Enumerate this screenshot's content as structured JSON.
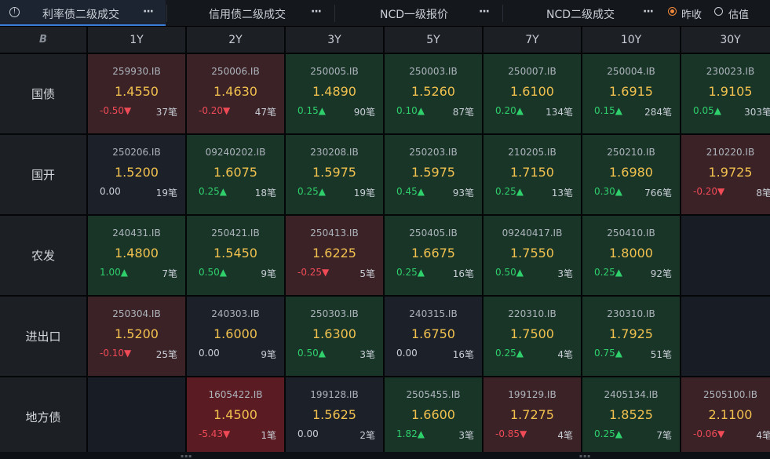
{
  "tabs": [
    {
      "label": "利率债二级成交",
      "more": "···",
      "active": true
    },
    {
      "label": "信用债二级成交",
      "more": "···",
      "active": false
    },
    {
      "label": "NCD一级报价",
      "more": "···",
      "active": false
    },
    {
      "label": "NCD二级成交",
      "more": "···",
      "active": false
    }
  ],
  "radios": [
    {
      "label": "昨收",
      "selected": true
    },
    {
      "label": "估值",
      "selected": false
    }
  ],
  "corner_logo": "B",
  "columns": [
    "1Y",
    "2Y",
    "3Y",
    "5Y",
    "7Y",
    "10Y",
    "30Y"
  ],
  "rows": [
    {
      "label": "国债",
      "cells": [
        {
          "code": "259930.IB",
          "yield": "1.4550",
          "change": "-0.50▼",
          "count": "37笔",
          "tone": "r"
        },
        {
          "code": "250006.IB",
          "yield": "1.4630",
          "change": "-0.20▼",
          "count": "47笔",
          "tone": "r"
        },
        {
          "code": "250005.IB",
          "yield": "1.4890",
          "change": "0.15▲",
          "count": "90笔",
          "tone": "g"
        },
        {
          "code": "250003.IB",
          "yield": "1.5260",
          "change": "0.10▲",
          "count": "87笔",
          "tone": "g"
        },
        {
          "code": "250007.IB",
          "yield": "1.6100",
          "change": "0.20▲",
          "count": "134笔",
          "tone": "g"
        },
        {
          "code": "250004.IB",
          "yield": "1.6915",
          "change": "0.15▲",
          "count": "284笔",
          "tone": "g"
        },
        {
          "code": "230023.IB",
          "yield": "1.9105",
          "change": "0.05▲",
          "count": "303笔",
          "tone": "g"
        }
      ]
    },
    {
      "label": "国开",
      "cells": [
        {
          "code": "250206.IB",
          "yield": "1.5200",
          "change": "0.00",
          "count": "19笔",
          "tone": "n"
        },
        {
          "code": "09240202.IB",
          "yield": "1.6075",
          "change": "0.25▲",
          "count": "18笔",
          "tone": "g"
        },
        {
          "code": "230208.IB",
          "yield": "1.5975",
          "change": "0.25▲",
          "count": "19笔",
          "tone": "g"
        },
        {
          "code": "250203.IB",
          "yield": "1.5975",
          "change": "0.45▲",
          "count": "93笔",
          "tone": "g"
        },
        {
          "code": "210205.IB",
          "yield": "1.7150",
          "change": "0.25▲",
          "count": "13笔",
          "tone": "g"
        },
        {
          "code": "250210.IB",
          "yield": "1.6980",
          "change": "0.30▲",
          "count": "766笔",
          "tone": "g"
        },
        {
          "code": "210220.IB",
          "yield": "1.9725",
          "change": "-0.20▼",
          "count": "8笔",
          "tone": "r"
        }
      ]
    },
    {
      "label": "农发",
      "cells": [
        {
          "code": "240431.IB",
          "yield": "1.4800",
          "change": "1.00▲",
          "count": "7笔",
          "tone": "g"
        },
        {
          "code": "250421.IB",
          "yield": "1.5450",
          "change": "0.50▲",
          "count": "9笔",
          "tone": "g"
        },
        {
          "code": "250413.IB",
          "yield": "1.6225",
          "change": "-0.25▼",
          "count": "5笔",
          "tone": "r"
        },
        {
          "code": "250405.IB",
          "yield": "1.6675",
          "change": "0.25▲",
          "count": "16笔",
          "tone": "g"
        },
        {
          "code": "09240417.IB",
          "yield": "1.7550",
          "change": "0.50▲",
          "count": "3笔",
          "tone": "g"
        },
        {
          "code": "250410.IB",
          "yield": "1.8000",
          "change": "0.25▲",
          "count": "92笔",
          "tone": "g"
        },
        null
      ]
    },
    {
      "label": "进出口",
      "cells": [
        {
          "code": "250304.IB",
          "yield": "1.5200",
          "change": "-0.10▼",
          "count": "25笔",
          "tone": "r"
        },
        {
          "code": "240303.IB",
          "yield": "1.6000",
          "change": "0.00",
          "count": "9笔",
          "tone": "n"
        },
        {
          "code": "250303.IB",
          "yield": "1.6300",
          "change": "0.50▲",
          "count": "3笔",
          "tone": "g"
        },
        {
          "code": "240315.IB",
          "yield": "1.6750",
          "change": "0.00",
          "count": "16笔",
          "tone": "n"
        },
        {
          "code": "220310.IB",
          "yield": "1.7500",
          "change": "0.25▲",
          "count": "4笔",
          "tone": "g"
        },
        {
          "code": "230310.IB",
          "yield": "1.7925",
          "change": "0.75▲",
          "count": "51笔",
          "tone": "g"
        },
        null
      ]
    },
    {
      "label": "地方债",
      "cells": [
        null,
        {
          "code": "1605422.IB",
          "yield": "1.4500",
          "change": "-5.43▼",
          "count": "1笔",
          "tone": "rr"
        },
        {
          "code": "199128.IB",
          "yield": "1.5625",
          "change": "0.00",
          "count": "2笔",
          "tone": "n"
        },
        {
          "code": "2505455.IB",
          "yield": "1.6600",
          "change": "1.82▲",
          "count": "3笔",
          "tone": "g"
        },
        {
          "code": "199129.IB",
          "yield": "1.7275",
          "change": "-0.85▼",
          "count": "4笔",
          "tone": "r"
        },
        {
          "code": "2405134.IB",
          "yield": "1.8525",
          "change": "0.25▲",
          "count": "7笔",
          "tone": "g"
        },
        {
          "code": "2505100.IB",
          "yield": "2.1100",
          "change": "-0.06▼",
          "count": "4笔",
          "tone": "r"
        }
      ]
    }
  ],
  "colors": {
    "up": "#2fcf6c",
    "down": "#f04a57",
    "yield": "#f2c14e",
    "accent": "#f0883a"
  }
}
